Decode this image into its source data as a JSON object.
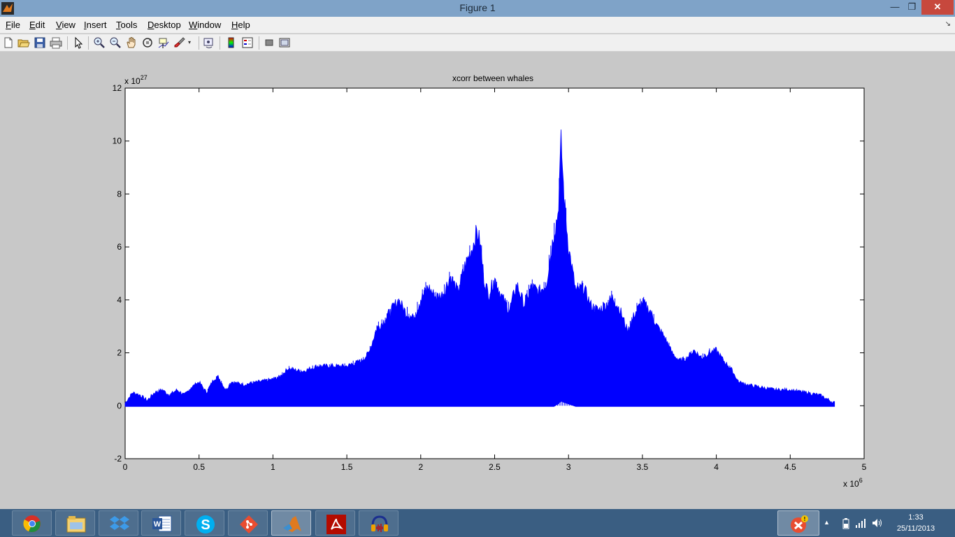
{
  "window": {
    "title": "Figure 1"
  },
  "menu": [
    {
      "key": "F",
      "rest": "ile"
    },
    {
      "key": "E",
      "rest": "dit"
    },
    {
      "key": "V",
      "rest": "iew"
    },
    {
      "key": "I",
      "rest": "nsert"
    },
    {
      "key": "T",
      "rest": "ools"
    },
    {
      "key": "D",
      "rest": "esktop"
    },
    {
      "key": "W",
      "rest": "indow"
    },
    {
      "key": "H",
      "rest": "elp"
    }
  ],
  "toolbar": [
    "new-figure-icon",
    "open-file-icon",
    "save-icon",
    "print-icon",
    "pointer-icon",
    "zoom-in-icon",
    "zoom-out-icon",
    "pan-hand-icon",
    "rotate-3d-icon",
    "data-cursor-icon",
    "brush-icon",
    "link-plot-icon",
    "colorbar-icon",
    "legend-icon",
    "hide-plot-tools-icon",
    "show-plot-tools-icon"
  ],
  "chart_data": {
    "type": "line",
    "title": "xcorr between whales",
    "xlabel": "",
    "ylabel": "",
    "x_exponent_label": "x 10",
    "x_exponent": "6",
    "y_exponent_label": "x 10",
    "y_exponent": "27",
    "xlim": [
      0,
      5
    ],
    "ylim": [
      -2,
      12
    ],
    "xticks": [
      "0",
      "0.5",
      "1",
      "1.5",
      "2",
      "2.5",
      "3",
      "3.5",
      "4",
      "4.5",
      "5"
    ],
    "yticks": [
      "-2",
      "0",
      "2",
      "4",
      "6",
      "8",
      "10",
      "12"
    ],
    "series": [
      {
        "color": "#0000ff",
        "envelope_x": [
          0,
          0.05,
          0.1,
          0.15,
          0.2,
          0.25,
          0.3,
          0.35,
          0.4,
          0.45,
          0.5,
          0.55,
          0.6,
          0.63,
          0.68,
          0.72,
          0.8,
          0.9,
          1.0,
          1.05,
          1.1,
          1.2,
          1.3,
          1.4,
          1.5,
          1.6,
          1.65,
          1.7,
          1.75,
          1.8,
          1.85,
          1.9,
          1.95,
          2.0,
          2.05,
          2.1,
          2.15,
          2.2,
          2.25,
          2.3,
          2.35,
          2.38,
          2.4,
          2.43,
          2.46,
          2.5,
          2.55,
          2.6,
          2.65,
          2.7,
          2.75,
          2.8,
          2.85,
          2.9,
          2.93,
          2.95,
          2.97,
          3.0,
          3.05,
          3.1,
          3.15,
          3.2,
          3.25,
          3.3,
          3.35,
          3.4,
          3.45,
          3.5,
          3.55,
          3.6,
          3.65,
          3.7,
          3.75,
          3.8,
          3.85,
          3.9,
          3.95,
          4.0,
          4.05,
          4.1,
          4.15,
          4.2,
          4.3,
          4.4,
          4.5,
          4.6,
          4.7,
          4.8
        ],
        "envelope_y": [
          0.1,
          0.5,
          0.4,
          0.2,
          0.5,
          0.6,
          0.4,
          0.6,
          0.4,
          0.7,
          0.9,
          0.5,
          1.0,
          1.1,
          0.6,
          0.9,
          0.8,
          0.9,
          1.0,
          1.1,
          1.4,
          1.3,
          1.5,
          1.5,
          1.5,
          1.7,
          2.0,
          2.9,
          3.2,
          3.6,
          4.0,
          3.5,
          3.3,
          4.0,
          4.5,
          4.1,
          4.2,
          4.9,
          4.3,
          5.3,
          6.0,
          6.6,
          6.2,
          4.7,
          4.2,
          4.8,
          4.1,
          3.6,
          4.6,
          3.8,
          4.5,
          4.3,
          4.6,
          6.5,
          7.3,
          10.0,
          7.8,
          6.0,
          4.3,
          4.5,
          3.8,
          3.6,
          3.8,
          4.1,
          3.6,
          2.8,
          3.5,
          3.9,
          3.6,
          3.0,
          2.6,
          2.0,
          1.7,
          1.8,
          2.1,
          1.8,
          2.0,
          2.1,
          1.7,
          1.4,
          0.9,
          0.8,
          0.7,
          0.6,
          0.6,
          0.5,
          0.4,
          0.1
        ],
        "lower_y": [
          0,
          0,
          0,
          0,
          0,
          0,
          0,
          0,
          0,
          0,
          0,
          0,
          0,
          0,
          0,
          0,
          0,
          0,
          0,
          0,
          0,
          0,
          0,
          0,
          0,
          0,
          0,
          0,
          0,
          0,
          0,
          0,
          0,
          0,
          0,
          0,
          0,
          0,
          0,
          0,
          0,
          0,
          0,
          0,
          0,
          0,
          0,
          0,
          0,
          0,
          0,
          0,
          0,
          0,
          0.1,
          0.2,
          0.15,
          0.1,
          0,
          0,
          0,
          0,
          0,
          0,
          0,
          0,
          0,
          0,
          0,
          0,
          0,
          0,
          0,
          0,
          0,
          0,
          0,
          0,
          0,
          0,
          0,
          0,
          0,
          0,
          0,
          0,
          0,
          0
        ]
      }
    ],
    "grid": false,
    "box": true
  },
  "taskbar": {
    "apps": [
      "chrome-icon",
      "file-explorer-icon",
      "dropbox-icon",
      "word-icon",
      "skype-icon",
      "git-icon",
      "matlab-icon",
      "acrobat-icon",
      "audacity-icon"
    ],
    "time": "1:33",
    "date": "25/11/2013"
  }
}
